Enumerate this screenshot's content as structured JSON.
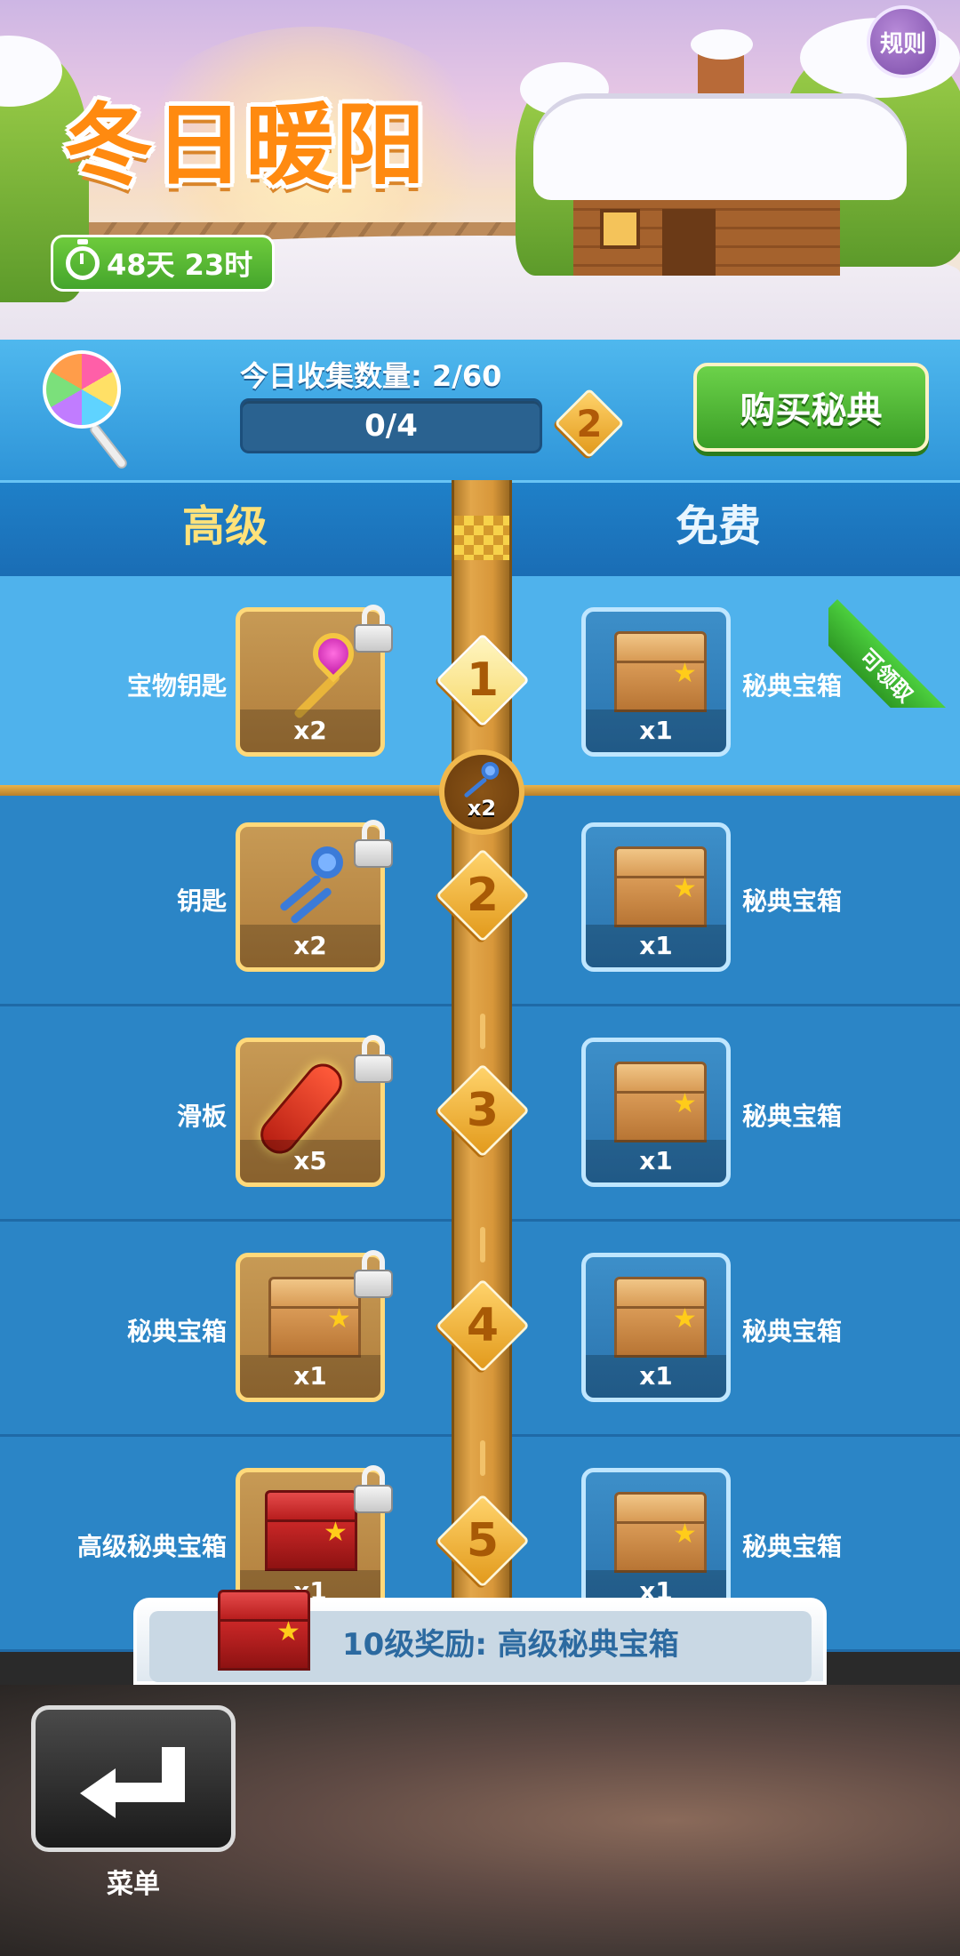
{
  "header": {
    "title": "冬日暖阳",
    "timer": "48天 23时",
    "rules_label": "规则"
  },
  "collect": {
    "label": "今日收集数量: 2/60",
    "progress_text": "0/4",
    "progress_fraction": 0.0,
    "level": "2",
    "buy_label": "购买秘典"
  },
  "columns": {
    "premium": "高级",
    "free": "免费"
  },
  "claimable_tag": "可领取",
  "rows": [
    {
      "level": "1",
      "premium_label": "宝物钥匙",
      "premium_qty": "x2",
      "premium_icon": "treasure-key-icon",
      "free_label": "秘典宝箱",
      "free_qty": "x1",
      "free_icon": "chest-icon"
    },
    {
      "level": "2",
      "premium_label": "钥匙",
      "premium_qty": "x2",
      "premium_icon": "keys-icon",
      "free_label": "秘典宝箱",
      "free_qty": "x1",
      "free_icon": "chest-icon"
    },
    {
      "level": "3",
      "premium_label": "滑板",
      "premium_qty": "x5",
      "premium_icon": "hoverboard-icon",
      "free_label": "秘典宝箱",
      "free_qty": "x1",
      "free_icon": "chest-icon"
    },
    {
      "level": "4",
      "premium_label": "秘典宝箱",
      "premium_qty": "x1",
      "premium_icon": "chest-icon",
      "free_label": "秘典宝箱",
      "free_qty": "x1",
      "free_icon": "chest-icon"
    },
    {
      "level": "5",
      "premium_label": "高级秘典宝箱",
      "premium_qty": "x1",
      "premium_icon": "premium-chest-icon",
      "free_label": "秘典宝箱",
      "free_qty": "x1",
      "free_icon": "chest-icon"
    }
  ],
  "marker": {
    "qty": "x2",
    "icon": "keys-icon"
  },
  "bonus_banner": "10级奖励: 高级秘典宝箱",
  "bottom": {
    "menu_label": "菜单"
  },
  "colors": {
    "accent_green": "#44a52c",
    "accent_gold": "#ffd97a",
    "list_blue": "#2b85c6",
    "active_row": "#4fb2ec"
  }
}
